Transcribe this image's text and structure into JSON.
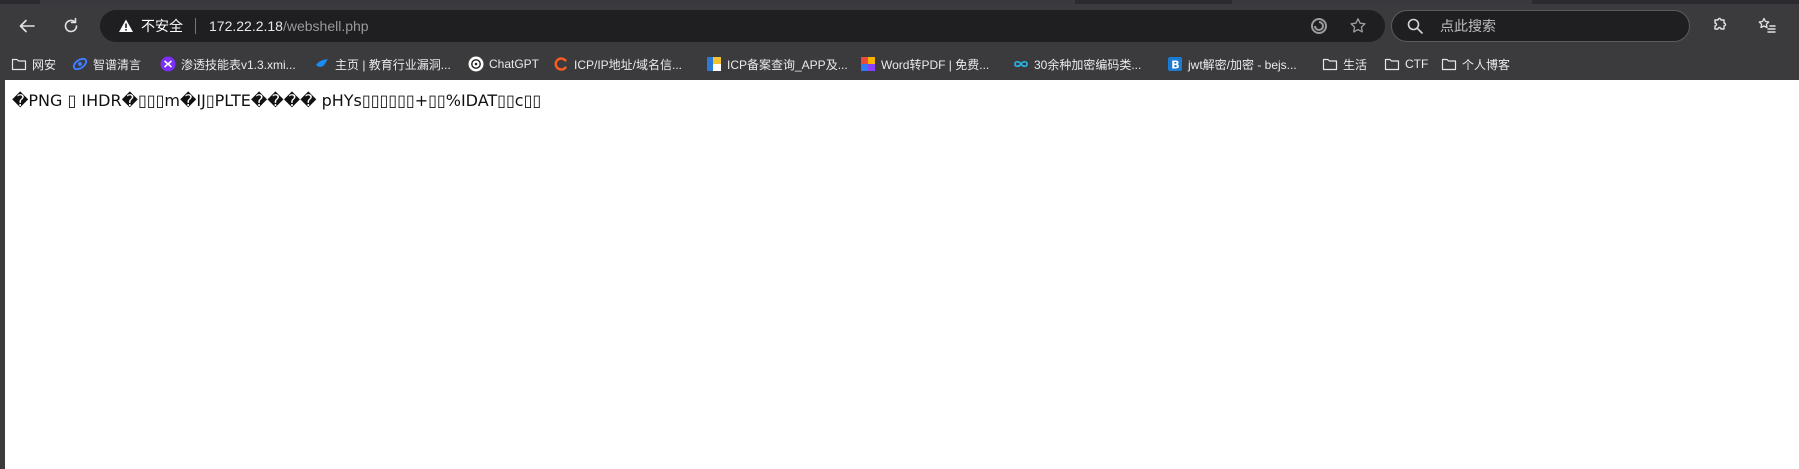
{
  "toolbar": {
    "back": "back",
    "refresh": "refresh"
  },
  "address_bar": {
    "security_label": "不安全",
    "url_host": "172.22.2.18",
    "url_path": "/webshell.php"
  },
  "search": {
    "placeholder": "点此搜索"
  },
  "bookmarks": [
    {
      "label": "网安",
      "icon": "folder-icon"
    },
    {
      "label": "智谱清言",
      "icon": "zhipu-icon"
    },
    {
      "label": "渗透技能表v1.3.xmi...",
      "icon": "xmind-icon"
    },
    {
      "label": "主页 | 教育行业漏洞...",
      "icon": "edu-bird-icon"
    },
    {
      "label": "ChatGPT",
      "icon": "openai-icon"
    },
    {
      "label": "ICP/IP地址/域名信...",
      "icon": "icp-c-icon"
    },
    {
      "label": "ICP备案查询_APP及...",
      "icon": "icp-flag-icon"
    },
    {
      "label": "Word转PDF | 免费...",
      "icon": "word-pdf-icon"
    },
    {
      "label": "30余种加密编码类...",
      "icon": "infinity-icon"
    },
    {
      "label": "jwt解密/加密 - bejs...",
      "icon": "bejson-icon"
    },
    {
      "label": "生活",
      "icon": "folder-icon"
    },
    {
      "label": "CTF",
      "icon": "folder-icon"
    },
    {
      "label": "个人博客",
      "icon": "folder-icon"
    }
  ],
  "page": {
    "body_text": "�PNG ▯ IHDR�▯▯▯m�IJ▯PLTE���� pHYs▯▯▯▯▯▯+▯▯%IDAT▯▯c▯▯"
  },
  "colors": {
    "chrome": "#3b3b3e",
    "field": "#1f1f22",
    "content": "#ffffff"
  }
}
